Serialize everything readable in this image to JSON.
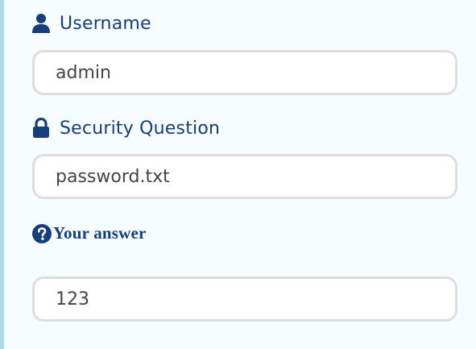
{
  "form": {
    "username": {
      "label": "Username",
      "icon": "user-icon",
      "value": "admin"
    },
    "security_question": {
      "label": "Security Question",
      "icon": "lock-icon",
      "value": "password.txt"
    },
    "answer": {
      "label": "Your answer",
      "icon": "question-circle-icon",
      "value": "123"
    }
  },
  "colors": {
    "label": "#153e7e",
    "field_border": "#dedede",
    "background": "#f7fcfe",
    "accent_bar": "#a8dbe8",
    "link": "#1a9bb5"
  }
}
